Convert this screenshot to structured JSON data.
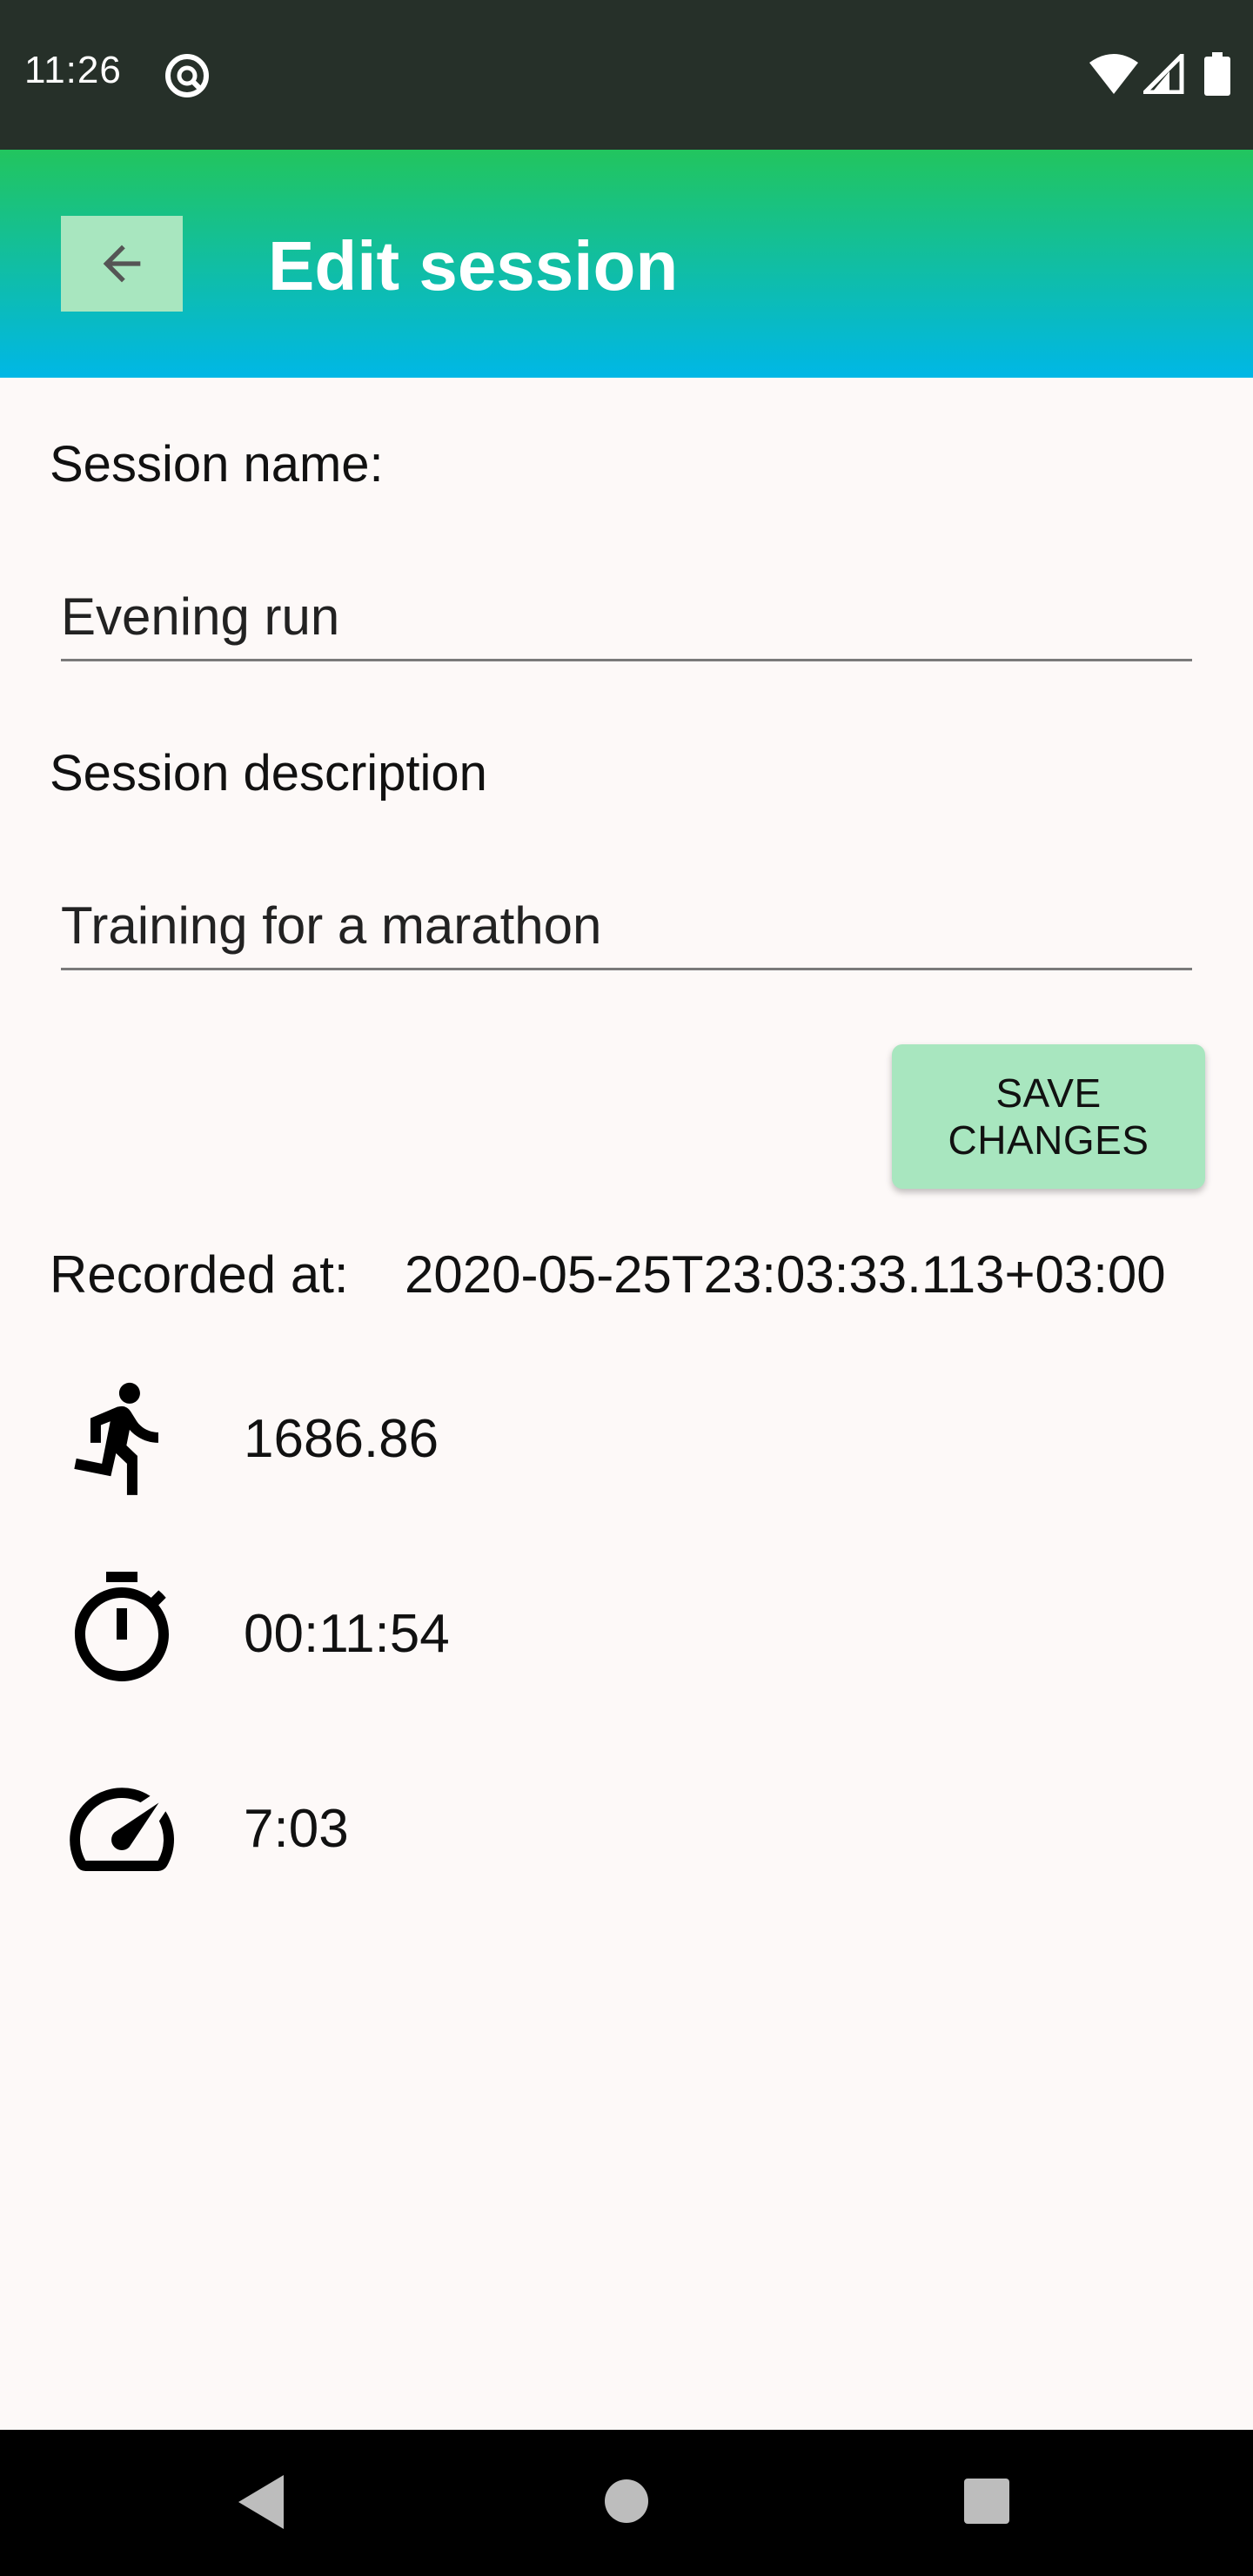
{
  "status_bar": {
    "time": "11:26",
    "icons": [
      "app-notification-icon",
      "wifi-icon",
      "cell-signal-icon",
      "battery-icon"
    ]
  },
  "app_bar": {
    "title": "Edit session",
    "back_icon": "arrow-back-icon",
    "gradient": [
      "#22c55e",
      "#00b7e6"
    ]
  },
  "form": {
    "name_label": "Session name:",
    "name_value": "Evening run",
    "description_label": "Session description",
    "description_value": "Training for a marathon",
    "save_label": "SAVE CHANGES"
  },
  "details": {
    "recorded_label": "Recorded at:",
    "recorded_value": "2020-05-25T23:03:33.113+03:00",
    "distance": "1686.86",
    "duration": "00:11:54",
    "pace": "7:03"
  },
  "nav_bar": {
    "icons": [
      "nav-back-icon",
      "nav-home-icon",
      "nav-recents-icon"
    ]
  },
  "colors": {
    "status_bar": "#263029",
    "button_bg": "#a8e6bf",
    "page_bg": "#fdf9f8"
  }
}
